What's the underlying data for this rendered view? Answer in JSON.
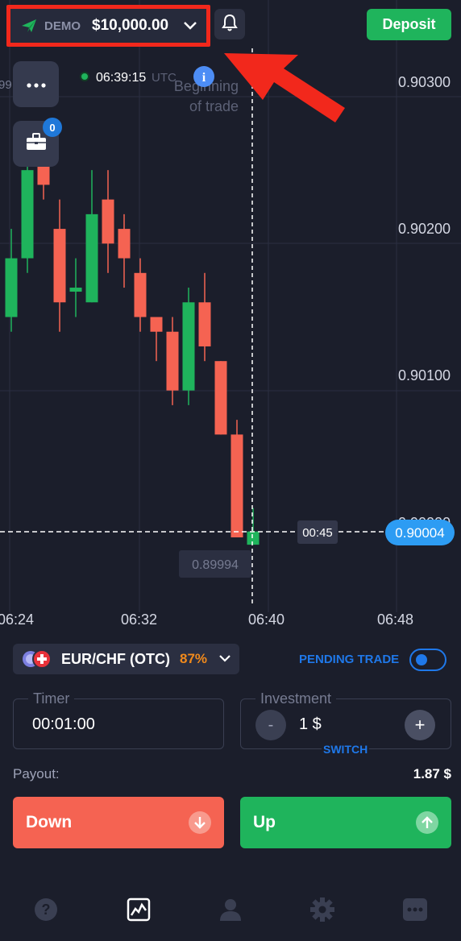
{
  "account": {
    "mode": "DEMO",
    "balance": "$10,000.00"
  },
  "header": {
    "deposit_label": "Deposit"
  },
  "chart": {
    "current_time": "06:39:15",
    "timezone": "UTC",
    "marker_label_line1": "Beginning",
    "marker_label_line2": "of trade",
    "timer": "00:45",
    "current_price": "0.90004",
    "low_price": "0.89994",
    "left_partial_label": "99",
    "price_labels": [
      "0.90300",
      "0.90200",
      "0.90100",
      "0.90000"
    ],
    "time_labels": [
      "06:24",
      "06:32",
      "06:40",
      "06:48"
    ],
    "briefcase_count": "0"
  },
  "chart_data": {
    "type": "candlestick",
    "ylim": [
      0.8996,
      0.90325
    ],
    "y_ticks": [
      0.903,
      0.902,
      0.901,
      0.9
    ],
    "x_ticks": [
      "06:24",
      "06:32",
      "06:40",
      "06:48"
    ],
    "candles": [
      {
        "open": 0.9015,
        "close": 0.9019,
        "high": 0.9021,
        "low": 0.9014,
        "dir": "up"
      },
      {
        "open": 0.9019,
        "close": 0.9025,
        "high": 0.9027,
        "low": 0.9018,
        "dir": "up"
      },
      {
        "open": 0.9027,
        "close": 0.9024,
        "high": 0.9028,
        "low": 0.9023,
        "dir": "down"
      },
      {
        "open": 0.9021,
        "close": 0.9016,
        "high": 0.9023,
        "low": 0.9014,
        "dir": "down"
      },
      {
        "open": 0.9017,
        "close": 0.9017,
        "high": 0.9019,
        "low": 0.9015,
        "dir": "up"
      },
      {
        "open": 0.9016,
        "close": 0.9022,
        "high": 0.9025,
        "low": 0.9016,
        "dir": "up"
      },
      {
        "open": 0.9023,
        "close": 0.902,
        "high": 0.9025,
        "low": 0.9018,
        "dir": "down"
      },
      {
        "open": 0.9021,
        "close": 0.9019,
        "high": 0.9022,
        "low": 0.9017,
        "dir": "down"
      },
      {
        "open": 0.9018,
        "close": 0.9015,
        "high": 0.9019,
        "low": 0.9014,
        "dir": "down"
      },
      {
        "open": 0.9015,
        "close": 0.9014,
        "high": 0.9015,
        "low": 0.9012,
        "dir": "down"
      },
      {
        "open": 0.9014,
        "close": 0.901,
        "high": 0.9015,
        "low": 0.9009,
        "dir": "down"
      },
      {
        "open": 0.901,
        "close": 0.9016,
        "high": 0.9017,
        "low": 0.9009,
        "dir": "up"
      },
      {
        "open": 0.9016,
        "close": 0.9013,
        "high": 0.9018,
        "low": 0.9012,
        "dir": "down"
      },
      {
        "open": 0.9012,
        "close": 0.9007,
        "high": 0.9012,
        "low": 0.9007,
        "dir": "down"
      },
      {
        "open": 0.9007,
        "close": 0.9,
        "high": 0.9008,
        "low": 0.9,
        "dir": "down"
      },
      {
        "open": 0.89995,
        "close": 0.90004,
        "high": 0.9002,
        "low": 0.89995,
        "dir": "up"
      }
    ]
  },
  "asset": {
    "name": "EUR/CHF (OTC)",
    "payout_percent": "87%"
  },
  "pending": {
    "label": "PENDING TRADE"
  },
  "timer": {
    "label": "Timer",
    "value": "00:01:00"
  },
  "investment": {
    "label": "Investment",
    "value": "1 $",
    "minus": "-",
    "plus": "+",
    "switch_label": "SWITCH"
  },
  "payout": {
    "label": "Payout:",
    "value": "1.87 $"
  },
  "trade": {
    "down_label": "Down",
    "up_label": "Up"
  },
  "nav": {
    "items": [
      "help-icon",
      "chart-icon",
      "profile-icon",
      "settings-icon",
      "chat-icon"
    ]
  },
  "colors": {
    "up": "#1fb45c",
    "down": "#f56352",
    "accent": "#1f78e9",
    "highlight": "#f2281c",
    "payout_orange": "#f28a1b"
  }
}
